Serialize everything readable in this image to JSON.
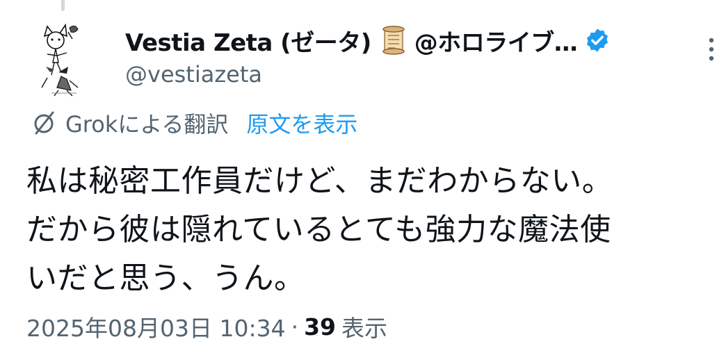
{
  "author": {
    "display_name": "Vestia Zeta (ゼータ)",
    "name_suffix": "@ホロライブ…",
    "handle": "@vestiazeta",
    "emoji_icon": "scroll-icon",
    "verified_icon": "verified-badge-icon"
  },
  "translation": {
    "label": "Grokによる翻訳",
    "show_original": "原文を表示"
  },
  "tweet": {
    "lines": [
      "私は秘密工作員だけど、まだわからない。",
      "だから彼は隠れているとても強力な魔法使",
      "いだと思う、うん。"
    ]
  },
  "meta": {
    "timestamp": "2025年08月03日 10:34",
    "separator": "·",
    "views": "39",
    "views_label": "表示"
  },
  "colors": {
    "text_primary": "#0f1419",
    "text_secondary": "#536471",
    "accent": "#1d9bf0"
  }
}
